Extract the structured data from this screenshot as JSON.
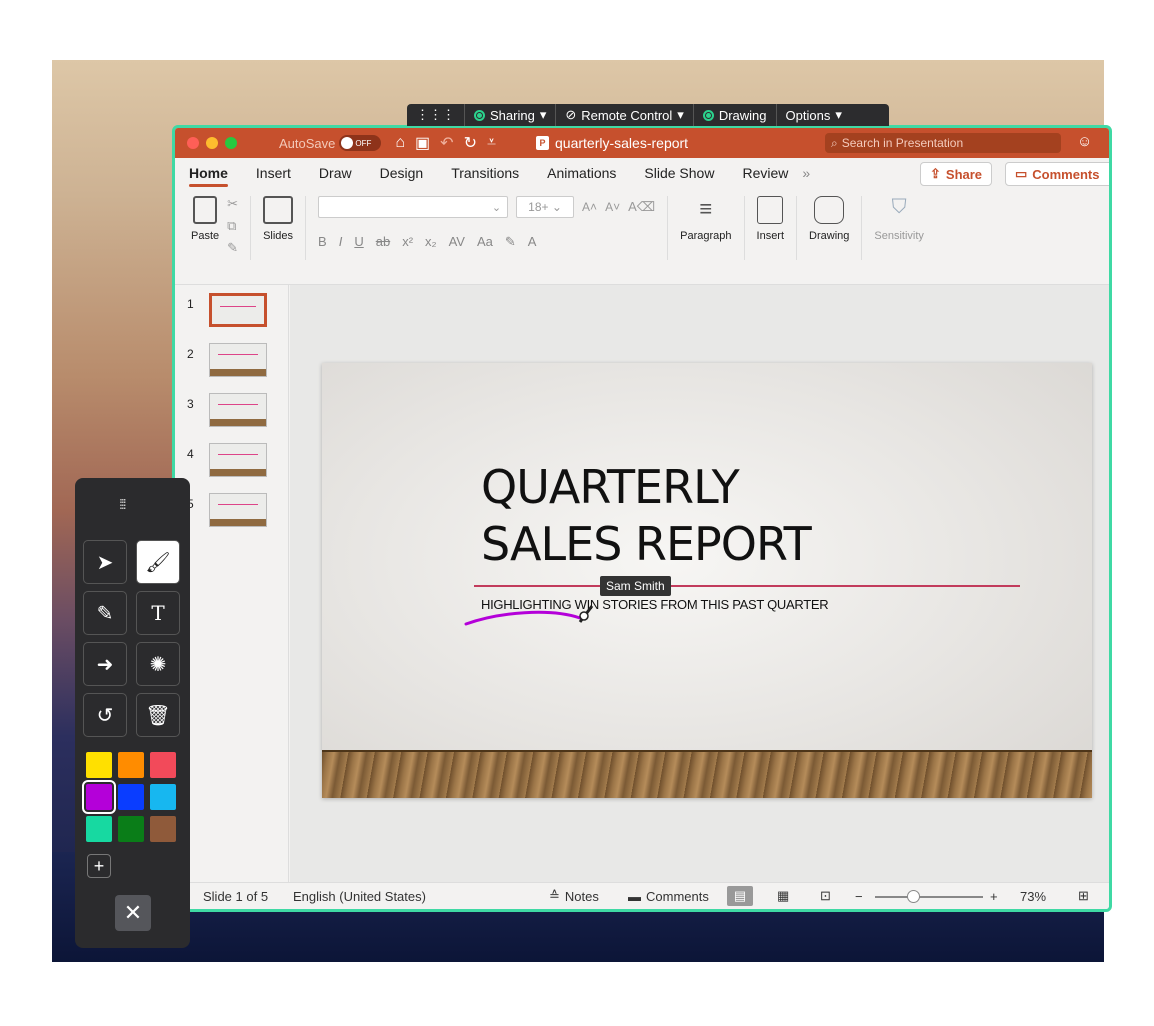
{
  "share_toolbar": {
    "grip": "⋮⋮⋮",
    "sharing": "Sharing",
    "remote_control": "Remote Control",
    "drawing": "Drawing",
    "options": "Options"
  },
  "titlebar": {
    "autosave": "AutoSave",
    "autosave_state": "OFF",
    "doc_title": "quarterly-sales-report",
    "search_placeholder": "Search in Presentation"
  },
  "ribbon_tabs": [
    "Home",
    "Insert",
    "Draw",
    "Design",
    "Transitions",
    "Animations",
    "Slide Show",
    "Review"
  ],
  "ribbon_actions": {
    "share": "Share",
    "comments": "Comments"
  },
  "ribbon_groups": {
    "paste": "Paste",
    "slides": "Slides",
    "font_size": "18+",
    "paragraph": "Paragraph",
    "insert": "Insert",
    "drawing": "Drawing",
    "sensitivity": "Sensitivity"
  },
  "thumbnails": [
    "1",
    "2",
    "3",
    "4",
    "5"
  ],
  "slide": {
    "title_line1": "QUARTERLY",
    "title_line2": "SALES REPORT",
    "subtitle": "HIGHLIGHTING WIN STORIES FROM THIS PAST QUARTER"
  },
  "cursor_label": "Sam Smith",
  "statusbar": {
    "slide_count": "Slide 1 of 5",
    "language": "English (United States)",
    "notes": "Notes",
    "comments": "Comments",
    "zoom": "73%"
  },
  "palette": {
    "colors": [
      "#ffe000",
      "#ff8c00",
      "#f24a5a",
      "#b400d9",
      "#0a3dff",
      "#17b7f0",
      "#17d9a1",
      "#0a7d18",
      "#8f5a3a"
    ],
    "selected_color": "#b400d9"
  },
  "accent": "#c6502d"
}
